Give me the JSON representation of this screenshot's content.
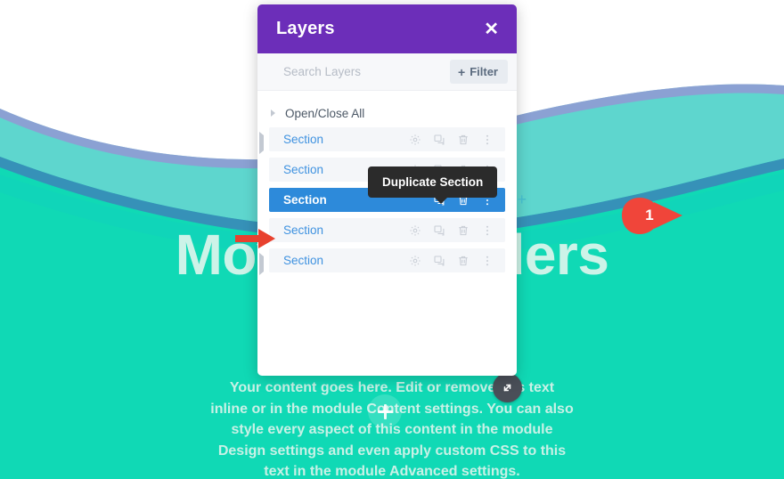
{
  "page": {
    "heading": "Moving Dividers",
    "body_text": "Your content goes here. Edit or remove this text inline or in the module Content settings. You can also style every aspect of this content in the module Design settings and even apply custom CSS to this text in the module Advanced settings.",
    "background_colors": {
      "white": "#ffffff",
      "teal_light": "#5ed6ce",
      "teal_bright": "#10d9b5",
      "teal_mid": "#12cfc0",
      "purple_line": "#9b8fd4",
      "blue_line": "#3d84b8"
    },
    "heading_color": "#cdf3e8"
  },
  "panel": {
    "title": "Layers",
    "close_label": "✕",
    "search": {
      "placeholder": "Search Layers",
      "value": ""
    },
    "filter_button": {
      "plus": "+",
      "label": "Filter"
    },
    "open_close_all": "Open/Close All",
    "header_color": "#6c2eb9",
    "selected_row_color": "#2d8ada",
    "link_color": "#3f92e0",
    "rows": [
      {
        "label": "Section",
        "expandable": true,
        "selected": false
      },
      {
        "label": "Section",
        "expandable": false,
        "selected": false
      },
      {
        "label": "Section",
        "expandable": false,
        "selected": true
      },
      {
        "label": "Section",
        "expandable": false,
        "selected": false
      },
      {
        "label": "Section",
        "expandable": true,
        "selected": false
      }
    ],
    "row_icons": [
      "settings-gear-icon",
      "duplicate-icon",
      "trash-icon",
      "more-options-icon"
    ],
    "add_row_plus": "+"
  },
  "tooltip": {
    "text": "Duplicate Section"
  },
  "annotations": {
    "step_number": "1",
    "badge_color": "#f0453a",
    "arrow_color": "#e8412e"
  },
  "floating_controls": {
    "page_plus": "+",
    "resize_icon": "resize-diagonal-icon"
  }
}
